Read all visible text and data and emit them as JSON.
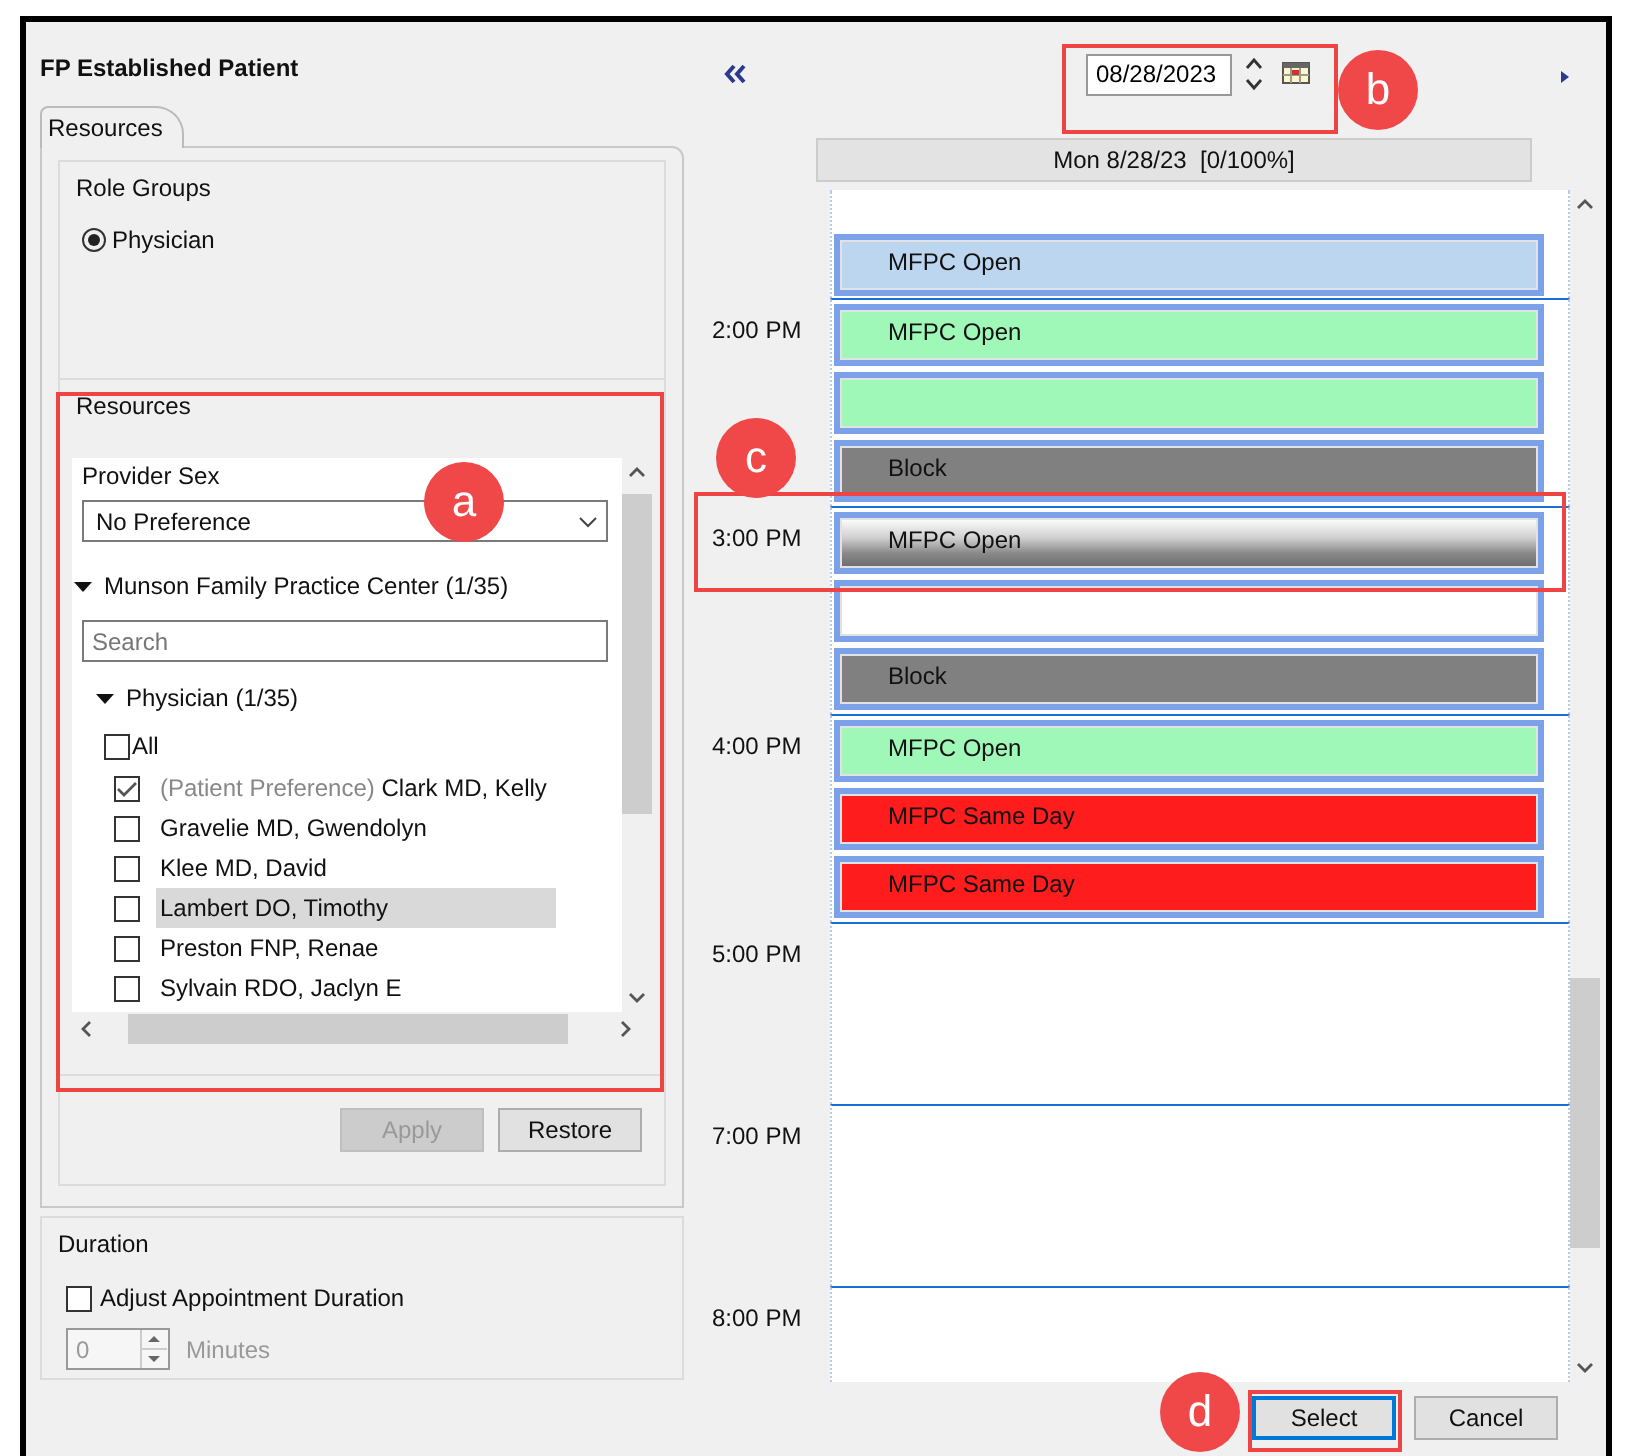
{
  "window": {
    "title": "FP Established Patient"
  },
  "tab": {
    "label": "Resources"
  },
  "role_groups": {
    "title": "Role Groups",
    "options": [
      {
        "label": "Physician",
        "selected": true
      }
    ]
  },
  "resources": {
    "title": "Resources",
    "provider_sex_label": "Provider Sex",
    "provider_sex": "No Preference",
    "location": {
      "label": "Munson Family Practice Center (1/35)",
      "expanded": true
    },
    "search": {
      "placeholder": "Search"
    },
    "group": {
      "label": "Physician (1/35)",
      "expanded": true
    },
    "all": {
      "label": "All",
      "checked": false
    },
    "providers": [
      {
        "note": "(Patient Preference)",
        "name": "Clark MD, Kelly",
        "checked": true,
        "selected": false
      },
      {
        "name": "Gravelie MD, Gwendolyn",
        "checked": false,
        "selected": false
      },
      {
        "name": "Klee MD, David",
        "checked": false,
        "selected": false
      },
      {
        "name": "Lambert DO, Timothy",
        "checked": false,
        "selected": true
      },
      {
        "name": "Preston FNP, Renae",
        "checked": false,
        "selected": false
      },
      {
        "name": "Sylvain RDO, Jaclyn E",
        "checked": false,
        "selected": false
      }
    ]
  },
  "resource_buttons": [
    {
      "label": "Apply",
      "disabled": true
    },
    {
      "label": "Restore",
      "disabled": false
    }
  ],
  "duration": {
    "title": "Duration",
    "adjust": {
      "label": "Adjust Appointment Duration",
      "checked": false
    },
    "minutes": {
      "value": "0",
      "unit": "Minutes",
      "disabled": true
    }
  },
  "calendar": {
    "date": "08/28/2023",
    "day_header": "Mon 8/28/23  [0/100%]",
    "hours": [
      {
        "slots": [
          {
            "label": "MFPC Open",
            "color": "#bcd6f0",
            "selected": false
          }
        ]
      },
      {
        "time": "2:00 PM",
        "slots": [
          {
            "label": "MFPC Open",
            "color": "#a0f8b8",
            "selected": false
          },
          {
            "color": "#a0f8b8",
            "selected": false
          },
          {
            "label": "Block",
            "color": "#808080",
            "selected": false
          }
        ]
      },
      {
        "time": "3:00 PM",
        "slots": [
          {
            "label": "MFPC Open",
            "color": "#808080",
            "selected": true
          },
          {
            "color": "#ffffff",
            "selected": false
          },
          {
            "label": "Block",
            "color": "#808080",
            "selected": false
          }
        ]
      },
      {
        "time": "4:00 PM",
        "slots": [
          {
            "label": "MFPC Open",
            "color": "#a0f8b8",
            "selected": false
          },
          {
            "label": "MFPC Same Day",
            "color": "#ff1c1c",
            "selected": false
          },
          {
            "label": "MFPC Same Day",
            "color": "#ff1c1c",
            "selected": false
          }
        ]
      },
      {
        "time": "5:00 PM"
      },
      {
        "time": "7:00 PM"
      },
      {
        "time": "8:00 PM"
      }
    ]
  },
  "buttons": [
    {
      "label": "Select",
      "focused": true
    },
    {
      "label": "Cancel",
      "focused": false
    }
  ],
  "callouts": [
    {
      "letter": "a"
    },
    {
      "letter": "b"
    },
    {
      "letter": "c"
    },
    {
      "letter": "d"
    }
  ]
}
